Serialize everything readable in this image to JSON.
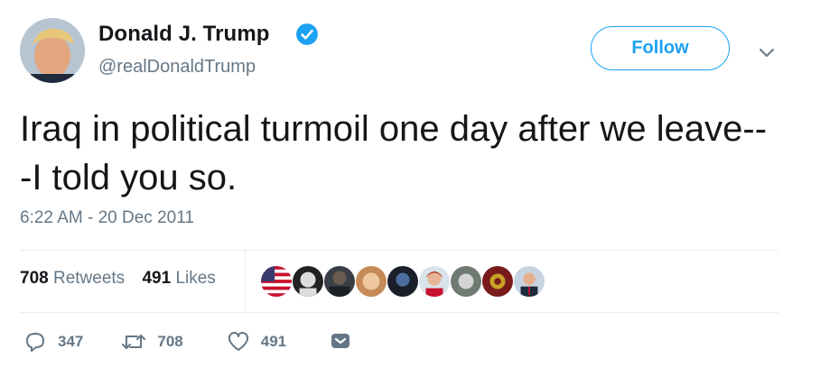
{
  "author": {
    "display_name": "Donald J. Trump",
    "handle": "@realDonaldTrump",
    "verified": true
  },
  "follow_label": "Follow",
  "tweet": {
    "text": "Iraq in political turmoil one day after we leave---I told you so.",
    "timestamp": "6:22 AM - 20 Dec 2011"
  },
  "stats": {
    "retweets_count": "708",
    "retweets_label": "Retweets",
    "likes_count": "491",
    "likes_label": "Likes"
  },
  "actions": {
    "reply_count": "347",
    "retweet_count": "708",
    "like_count": "491"
  },
  "colors": {
    "accent": "#1da1f2",
    "secondary_text": "#657786",
    "primary_text": "#14171a"
  },
  "icons": [
    "verified-badge-icon",
    "chevron-down-icon",
    "reply-icon",
    "retweet-icon",
    "heart-icon",
    "direct-message-icon"
  ]
}
